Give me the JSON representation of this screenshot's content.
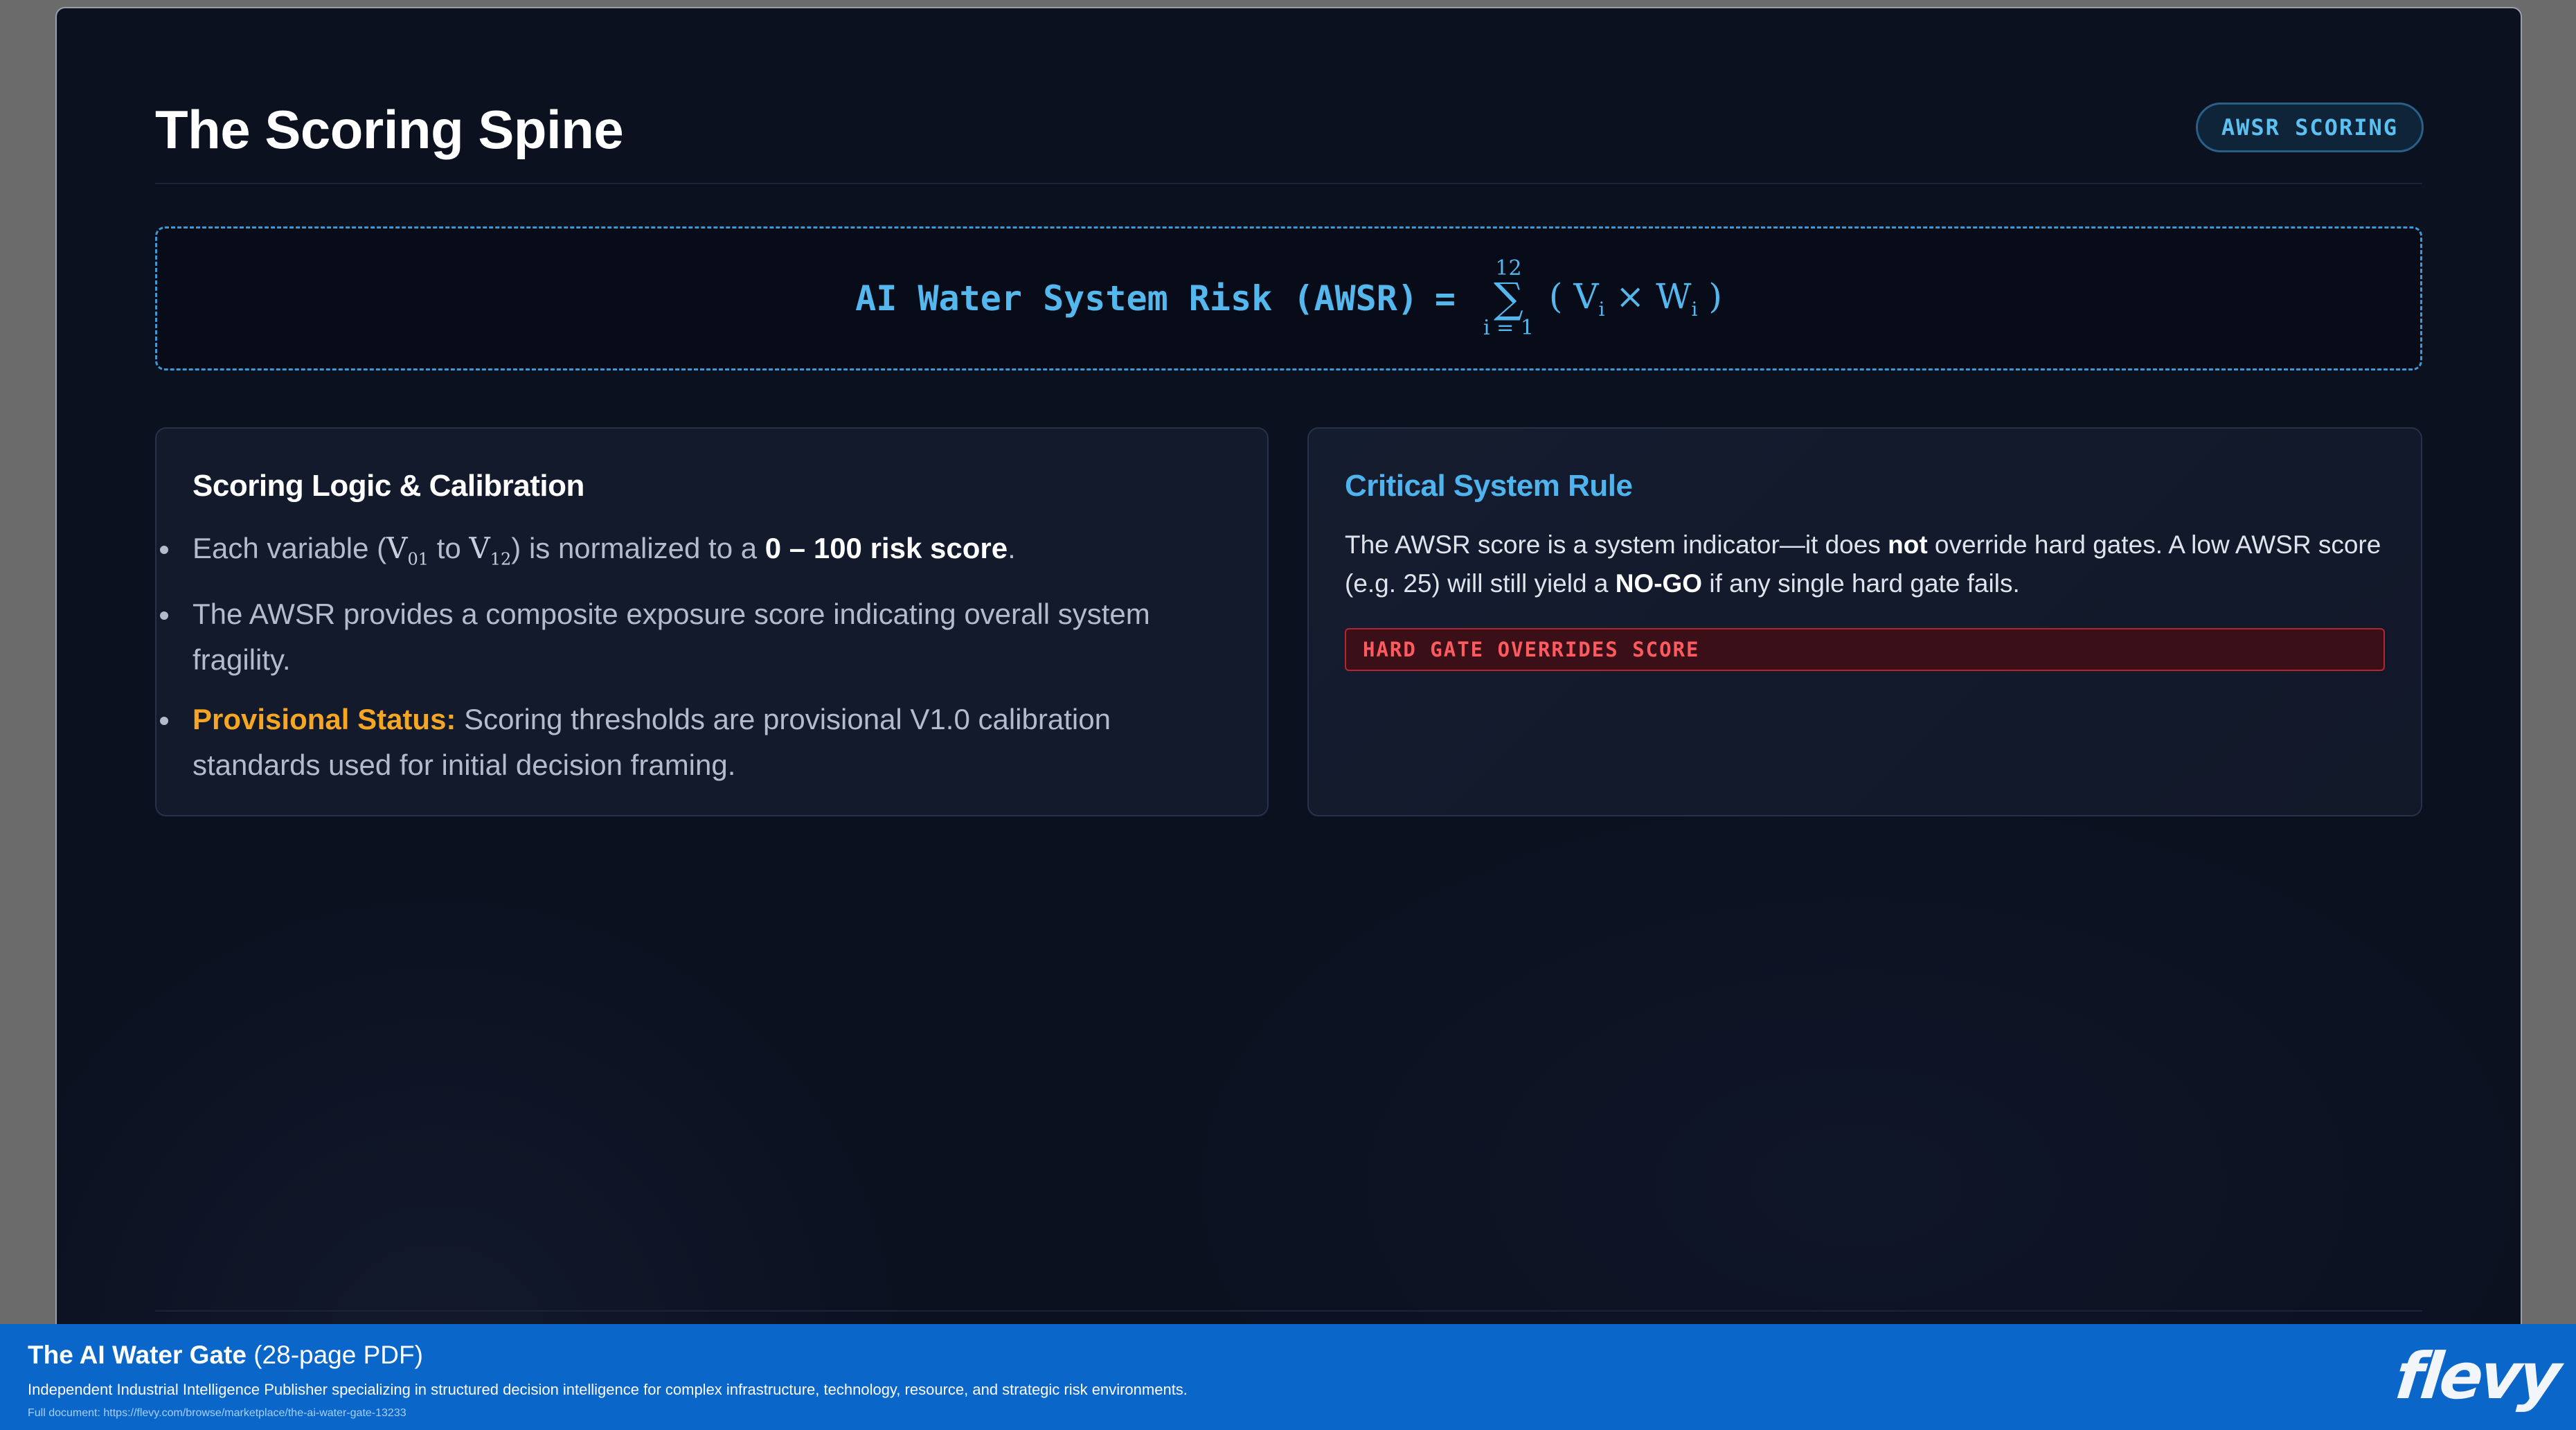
{
  "slide": {
    "title": "The Scoring Spine",
    "badge": "AWSR SCORING"
  },
  "formula": {
    "label": "AI Water System Risk (AWSR)",
    "equals": "=",
    "sum_upper": "12",
    "sum_symbol": "∑",
    "sum_lower": "i = 1",
    "term_open": "( V",
    "term_sub1": "i",
    "term_times": " × W",
    "term_sub2": "i",
    "term_close": " )"
  },
  "left_card": {
    "heading": "Scoring Logic & Calibration",
    "b1_pre": "Each variable (",
    "b1_v1": "V",
    "b1_v1_sub": "01",
    "b1_to": " to ",
    "b1_v2": "V",
    "b1_v2_sub": "12",
    "b1_mid": ") is normalized to a ",
    "b1_strong": "0 – 100 risk score",
    "b1_end": ".",
    "b2": "The AWSR provides a composite exposure score indicating overall system fragility.",
    "b3_label": "Provisional Status:",
    "b3_text": " Scoring thresholds are provisional V1.0 calibration standards used for initial decision framing."
  },
  "right_card": {
    "heading": "Critical System Rule",
    "t1": "The AWSR score is a system indicator—it does ",
    "t1_bold": "not",
    "t2": " override hard gates. A low AWSR score (e.g. 25) will still yield a ",
    "t2_bold": "NO-GO",
    "t3": " if any single hard gate fails.",
    "alert": "HARD GATE OVERRIDES SCORE"
  },
  "footer": {
    "title": "The AI Water Gate",
    "pages": " (28-page PDF)",
    "description": "Independent Industrial Intelligence Publisher specializing in structured decision intelligence for complex infrastructure, technology, resource, and strategic risk environments.",
    "link": "Full document: https://flevy.com/browse/marketplace/the-ai-water-gate-13233",
    "logo": "flevy"
  },
  "colors": {
    "accent": "#54b8ee",
    "provisional": "#f5a623",
    "alert": "#ff5a5f",
    "footer": "#0a66c8"
  }
}
